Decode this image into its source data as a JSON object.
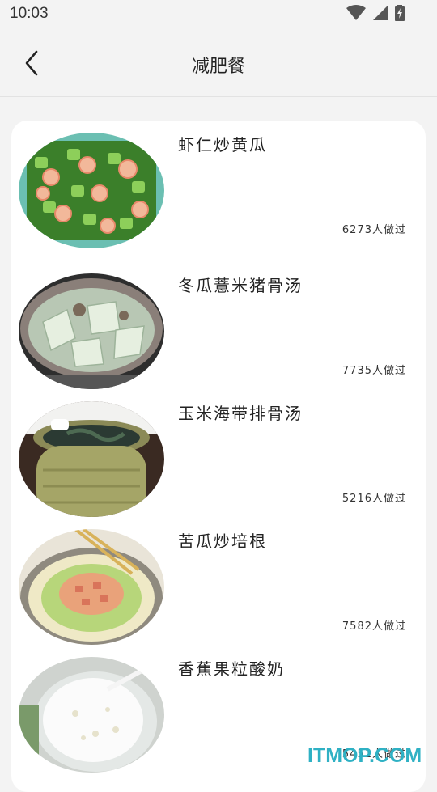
{
  "status_bar": {
    "time": "10:03",
    "icons": [
      "wifi-icon",
      "signal-icon",
      "battery-charging-icon"
    ]
  },
  "header": {
    "title": "减肥餐",
    "back_icon": "chevron-left-icon"
  },
  "recipes": [
    {
      "name": "虾仁炒黄瓜",
      "count": "6273人做过",
      "image": "shrimp-cucumber-photo"
    },
    {
      "name": "冬瓜薏米猪骨汤",
      "count": "7735人做过",
      "image": "winter-melon-soup-photo"
    },
    {
      "name": "玉米海带排骨汤",
      "count": "5216人做过",
      "image": "kelp-rib-soup-photo"
    },
    {
      "name": "苦瓜炒培根",
      "count": "7582人做过",
      "image": "bitter-melon-bacon-photo"
    },
    {
      "name": "香蕉果粒酸奶",
      "count": "5451人做过",
      "image": "banana-yogurt-photo"
    }
  ],
  "watermark": "ITMOP.COM",
  "colors": {
    "background": "#f3f3f3",
    "card": "#ffffff",
    "watermark": "#2fb1c4"
  }
}
